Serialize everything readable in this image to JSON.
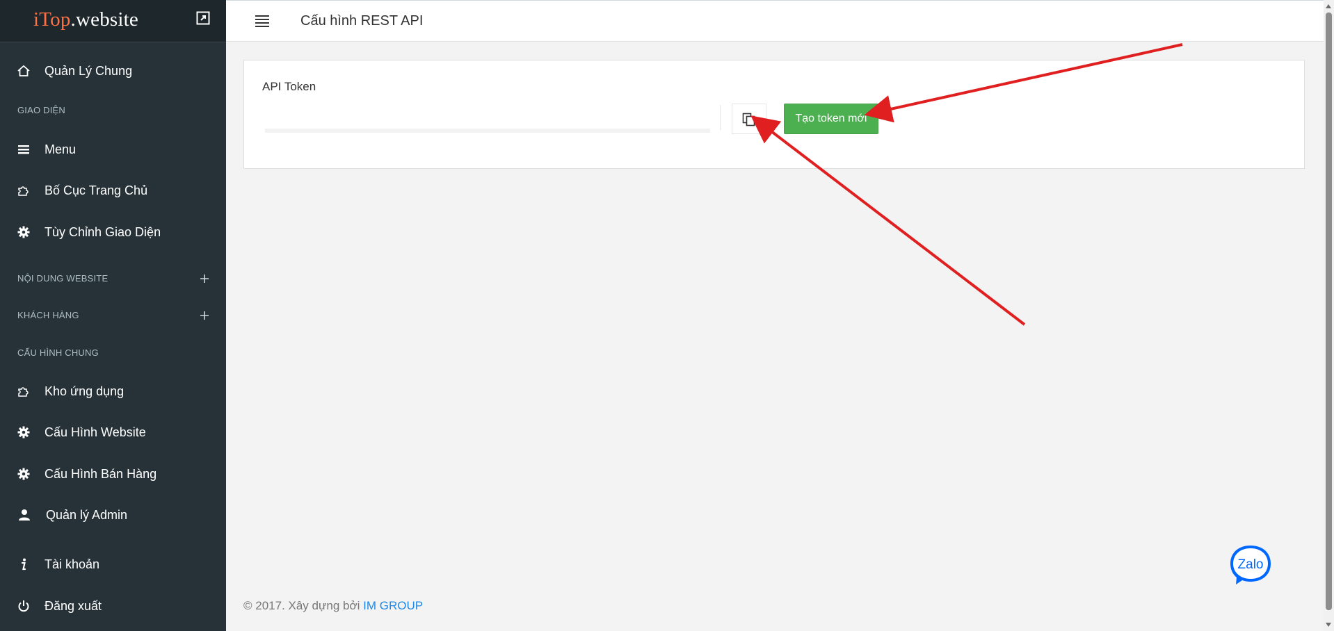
{
  "brand": {
    "logo_prefix": "iTop",
    "logo_suffix": ".website",
    "external_icon": "external-link-icon"
  },
  "sidebar": {
    "items": [
      {
        "label": "Quản Lý Chung",
        "icon": "home-icon"
      },
      {
        "label": "Menu",
        "icon": "bars-icon"
      },
      {
        "label": "Bố Cục Trang Chủ",
        "icon": "puzzle-icon"
      },
      {
        "label": "Tùy Chỉnh Giao Diện",
        "icon": "gear-icon"
      },
      {
        "label": "Kho ứng dụng",
        "icon": "puzzle-icon"
      },
      {
        "label": "Cấu Hình Website",
        "icon": "gear-icon"
      },
      {
        "label": "Cấu Hình Bán Hàng",
        "icon": "gear-icon"
      },
      {
        "label": "Quản lý Admin",
        "icon": "user-icon"
      },
      {
        "label": "Tài khoản",
        "icon": "info-icon"
      },
      {
        "label": "Đăng xuất",
        "icon": "power-icon"
      }
    ],
    "sections": [
      {
        "label": "GIAO DIỆN"
      },
      {
        "label": "NỘI DUNG WEBSITE",
        "expand_icon": "plus-icon"
      },
      {
        "label": "KHÁCH HÀNG",
        "expand_icon": "plus-icon"
      },
      {
        "label": "CẤU HÌNH CHUNG"
      }
    ]
  },
  "header": {
    "title": "Cấu hình REST API",
    "menu_icon": "hamburger-icon"
  },
  "card": {
    "label": "API Token",
    "token_value": "",
    "copy_icon": "copy-icon",
    "new_button_label": "Tạo token mới"
  },
  "footer": {
    "text": "© 2017. Xây dựng bởi ",
    "link_text": "IM GROUP"
  },
  "zalo": {
    "label": "Zalo"
  },
  "colors": {
    "sidebar_bg": "#263238",
    "accent": "#ff7043",
    "button_green": "#4caf50",
    "link_blue": "#1e88e5",
    "annotation_red": "#e02020"
  }
}
